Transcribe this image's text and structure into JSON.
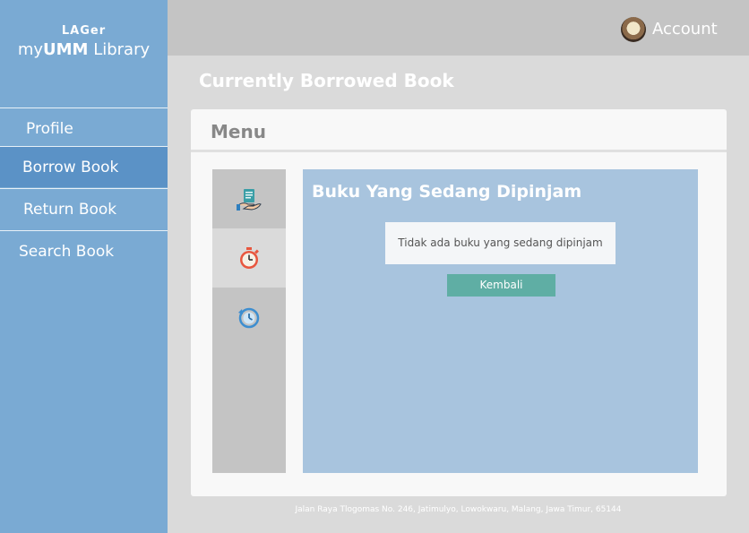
{
  "brand": {
    "logo_small": "LAGer",
    "logo_prefix": "my",
    "logo_bold": "UMM",
    "logo_suffix": " Library"
  },
  "sidebar": {
    "items": [
      {
        "label": "Profile",
        "active": false
      },
      {
        "label": "Borrow Book",
        "active": true
      },
      {
        "label": "Return Book",
        "active": false
      },
      {
        "label": "Search Book",
        "active": false
      }
    ]
  },
  "header": {
    "account_label": "Account"
  },
  "page": {
    "title": "Currently Borrowed Book"
  },
  "card": {
    "header": "Menu"
  },
  "tabs": [
    {
      "icon": "borrow-book-icon",
      "active": false
    },
    {
      "icon": "stopwatch-icon",
      "active": true
    },
    {
      "icon": "history-icon",
      "active": false
    }
  ],
  "content": {
    "title": "Buku Yang Sedang Dipinjam",
    "message": "Tidak ada buku yang sedang dipinjam",
    "button_label": "Kembali"
  },
  "footer": {
    "address": "Jalan Raya Tlogomas No. 246, Jatimulyo, Lowokwaru, Malang, Jawa Timur, 65144"
  },
  "colors": {
    "sidebar": "#7aaad3",
    "sidebar_active": "#5b92c6",
    "topbar": "#c4c4c4",
    "content_panel": "#a8c4de",
    "button": "#5faea4"
  }
}
